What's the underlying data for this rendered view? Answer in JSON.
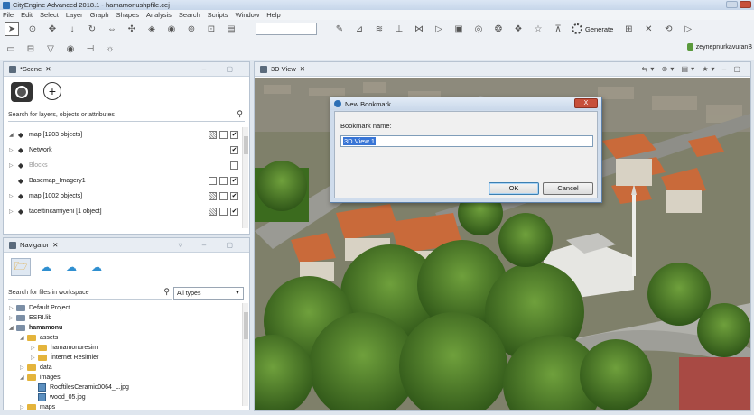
{
  "window": {
    "title": "CityEngine Advanced 2018.1 - hamamonushpfile.cej"
  },
  "menu": [
    "File",
    "Edit",
    "Select",
    "Layer",
    "Graph",
    "Shapes",
    "Analysis",
    "Search",
    "Scripts",
    "Window",
    "Help"
  ],
  "toolbar": {
    "generate_label": "Generate",
    "user": "zeynepnurkavuranB"
  },
  "scene_panel": {
    "tab_label": "*Scene",
    "search_placeholder": "Search for layers, objects or attributes",
    "layers": [
      {
        "label": "map [1203 objects]",
        "icon": "map-icon",
        "arrow": "◢",
        "boxes": [
          "hatch",
          "empty",
          "check"
        ]
      },
      {
        "label": "Network",
        "icon": "network-icon",
        "arrow": "▷",
        "boxes": [
          "check"
        ]
      },
      {
        "label": "Blocks",
        "icon": "blocks-icon",
        "arrow": "▷",
        "boxes": [
          "empty"
        ],
        "dim": true
      },
      {
        "label": "Basemap_Imagery1",
        "icon": "basemap-icon",
        "arrow": "",
        "boxes": [
          "empty",
          "empty",
          "check"
        ]
      },
      {
        "label": "map [1002 objects]",
        "icon": "map-icon",
        "arrow": "▷",
        "boxes": [
          "hatch",
          "empty",
          "check"
        ]
      },
      {
        "label": "tacettincamiyeni [1 object]",
        "icon": "object-icon",
        "arrow": "▷",
        "boxes": [
          "hatch",
          "empty",
          "check"
        ]
      }
    ]
  },
  "navigator_panel": {
    "tab_label": "Navigator",
    "search_placeholder": "Search for files in workspace",
    "filter_value": "All types",
    "tree": [
      {
        "label": "Default Project",
        "indent": 0,
        "kind": "project",
        "arrow": "▷"
      },
      {
        "label": "ESRI.lib",
        "indent": 0,
        "kind": "project",
        "arrow": "▷"
      },
      {
        "label": "hamamonu",
        "indent": 0,
        "kind": "project",
        "arrow": "◢",
        "bold": true
      },
      {
        "label": "assets",
        "indent": 1,
        "kind": "folder",
        "arrow": "◢"
      },
      {
        "label": "hamamonuresim",
        "indent": 2,
        "kind": "folder",
        "arrow": "▷"
      },
      {
        "label": "İnternet Resimler",
        "indent": 2,
        "kind": "folder",
        "arrow": "▷"
      },
      {
        "label": "data",
        "indent": 1,
        "kind": "folder",
        "arrow": "▷"
      },
      {
        "label": "images",
        "indent": 1,
        "kind": "folder",
        "arrow": "◢"
      },
      {
        "label": "RooftilesCeramic0064_L.jpg",
        "indent": 2,
        "kind": "image",
        "arrow": ""
      },
      {
        "label": "wood_05.jpg",
        "indent": 2,
        "kind": "image",
        "arrow": ""
      },
      {
        "label": "maps",
        "indent": 1,
        "kind": "folder",
        "arrow": "▷"
      }
    ]
  },
  "view3d": {
    "tab_label": "3D View"
  },
  "dialog": {
    "title": "New Bookmark",
    "label": "Bookmark name:",
    "value": "3D View 1",
    "ok_label": "OK",
    "cancel_label": "Cancel",
    "close_label": "X"
  }
}
